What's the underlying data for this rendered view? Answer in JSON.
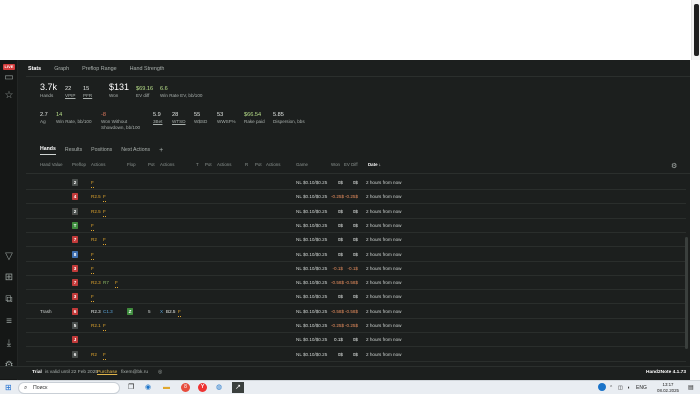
{
  "top_tabs": [
    "Stats",
    "Graph",
    "Preflop Range",
    "Hand Strength"
  ],
  "live_label": "LIVE",
  "stats": {
    "hands": {
      "value": "3.7k",
      "label": "Hands"
    },
    "vpip": {
      "value": "22",
      "label": "VPIP"
    },
    "pfr": {
      "value": "15",
      "label": "PFR"
    },
    "won": {
      "value": "$131",
      "label": "Won"
    },
    "ev_diff": {
      "value": "$69.16",
      "label": "EV diff"
    },
    "winrate_ev": {
      "value": "6.6",
      "label": "Win Rate EV, bb/100"
    },
    "ag": {
      "value": "2.7",
      "label": "Ag"
    },
    "winrate": {
      "value": "14",
      "label": "Win Rate, bb/100"
    },
    "won_without_sd": {
      "value": "-8",
      "label": "Won Without Showdown, bb/100"
    },
    "three_bet": {
      "value": "5.9",
      "label": "3Bet"
    },
    "wtsd": {
      "value": "28",
      "label": "WTSD"
    },
    "wsd": {
      "value": "55",
      "label": "W$SD"
    },
    "wwsf": {
      "value": "53",
      "label": "WWSF%"
    },
    "rake": {
      "value": "$66.54",
      "label": "Rake paid"
    },
    "dispersion": {
      "value": "5.85",
      "label": "Dispersion, bbs"
    }
  },
  "bottom_tabs": [
    "Hands",
    "Results",
    "Positions",
    "Next Actions"
  ],
  "plus_label": "+",
  "columns": {
    "hand_value": "Hand Value",
    "preflop": "Preflop",
    "actions1": "Actions",
    "flop": "Flop",
    "pot1": "Pot",
    "actions2": "Actions",
    "t": "T",
    "pot2": "Pot",
    "actions3": "Actions",
    "r": "R",
    "pot3": "Pot",
    "actions4": "Actions",
    "game": "Game",
    "won": "Won",
    "ev_diff": "EV Diff",
    "date": "Date",
    "sort_arrow": "↓"
  },
  "hands": [
    {
      "hand_value": "",
      "cards": [
        {
          "r": "8",
          "c": "black"
        },
        {
          "r": "2",
          "c": "black"
        }
      ],
      "preflop": [
        {
          "t": "F",
          "k": "f"
        }
      ],
      "flop_cards": [],
      "flop_actions": [],
      "game": "NL $0.10/$0.25",
      "won": "0$",
      "ev": "0$",
      "ev_kind": "zero",
      "date": "2 hours from now"
    },
    {
      "hand_value": "",
      "cards": [
        {
          "r": "K",
          "c": "black"
        },
        {
          "r": "4",
          "c": "red"
        }
      ],
      "preflop": [
        {
          "t": "R2.5",
          "k": "r"
        },
        {
          "t": "F",
          "k": "f"
        }
      ],
      "flop_cards": [],
      "flop_actions": [],
      "game": "NL $0.10/$0.25",
      "won": "-0.25$",
      "ev": "-0.25$",
      "ev_kind": "neg",
      "date": "2 hours from now"
    },
    {
      "hand_value": "",
      "cards": [
        {
          "r": "T",
          "c": "red"
        },
        {
          "r": "2",
          "c": "black"
        }
      ],
      "preflop": [
        {
          "t": "R2.5",
          "k": "r"
        },
        {
          "t": "F",
          "k": "f"
        }
      ],
      "flop_cards": [],
      "flop_actions": [],
      "game": "NL $0.10/$0.25",
      "won": "0$",
      "ev": "0$",
      "ev_kind": "zero",
      "date": "2 hours from now"
    },
    {
      "hand_value": "",
      "cards": [
        {
          "r": "Q",
          "c": "red"
        },
        {
          "r": "T",
          "c": "green"
        }
      ],
      "preflop": [
        {
          "t": "F",
          "k": "f"
        }
      ],
      "flop_cards": [],
      "flop_actions": [],
      "game": "NL $0.10/$0.25",
      "won": "0$",
      "ev": "0$",
      "ev_kind": "zero",
      "date": "2 hours from now"
    },
    {
      "hand_value": "",
      "cards": [
        {
          "r": "K",
          "c": "black"
        },
        {
          "r": "7",
          "c": "red"
        }
      ],
      "preflop": [
        {
          "t": "R2",
          "k": "r"
        },
        {
          "t": "F",
          "k": "f"
        }
      ],
      "flop_cards": [],
      "flop_actions": [],
      "game": "NL $0.10/$0.25",
      "won": "0$",
      "ev": "0$",
      "ev_kind": "zero",
      "date": "2 hours from now"
    },
    {
      "hand_value": "",
      "cards": [
        {
          "r": "9",
          "c": "green"
        },
        {
          "r": "8",
          "c": "blue"
        }
      ],
      "preflop": [
        {
          "t": "F",
          "k": "f"
        }
      ],
      "flop_cards": [],
      "flop_actions": [],
      "game": "NL $0.10/$0.25",
      "won": "0$",
      "ev": "0$",
      "ev_kind": "zero",
      "date": "2 hours from now"
    },
    {
      "hand_value": "",
      "cards": [
        {
          "r": "4",
          "c": "green"
        },
        {
          "r": "3",
          "c": "red"
        }
      ],
      "preflop": [
        {
          "t": "F",
          "k": "f"
        }
      ],
      "flop_cards": [],
      "flop_actions": [],
      "game": "NL $0.10/$0.25",
      "won": "-0.1$",
      "ev": "-0.1$",
      "ev_kind": "neg",
      "date": "2 hours from now"
    },
    {
      "hand_value": "",
      "cards": [
        {
          "r": "A",
          "c": "green"
        },
        {
          "r": "7",
          "c": "red"
        }
      ],
      "preflop": [
        {
          "t": "R2.3",
          "k": "r"
        },
        {
          "t": "R7",
          "k": "x"
        },
        {
          "t": "F",
          "k": "f"
        }
      ],
      "flop_cards": [],
      "flop_actions": [],
      "game": "NL $0.10/$0.25",
      "won": "-0.58$",
      "ev": "-0.58$",
      "ev_kind": "neg",
      "date": "2 hours from now"
    },
    {
      "hand_value": "",
      "cards": [
        {
          "r": "J",
          "c": "green"
        },
        {
          "r": "3",
          "c": "red"
        }
      ],
      "preflop": [
        {
          "t": "F",
          "k": "f"
        }
      ],
      "flop_cards": [],
      "flop_actions": [],
      "game": "NL $0.10/$0.25",
      "won": "0$",
      "ev": "0$",
      "ev_kind": "zero",
      "date": "2 hours from now"
    },
    {
      "hand_value": "Trash",
      "cards": [
        {
          "r": "8",
          "c": "red"
        },
        {
          "r": "6",
          "c": "red"
        }
      ],
      "preflop": [
        {
          "t": "R2.3",
          "k": "b"
        },
        {
          "t": "C1.3",
          "k": "c"
        }
      ],
      "flop_cards": [
        {
          "r": "J",
          "c": "black"
        },
        {
          "r": "9",
          "c": "red"
        },
        {
          "r": "Z",
          "c": "green"
        }
      ],
      "flop_pot": "5",
      "flop_actions": [
        {
          "t": "X",
          "k": "c"
        },
        {
          "t": "B2.5",
          "k": "b"
        },
        {
          "t": "F",
          "k": "f"
        }
      ],
      "game": "NL $0.10/$0.25",
      "won": "-0.58$",
      "ev": "-0.58$",
      "ev_kind": "neg",
      "date": "2 hours from now"
    },
    {
      "hand_value": "",
      "cards": [
        {
          "r": "K",
          "c": "blue"
        },
        {
          "r": "5",
          "c": "black"
        }
      ],
      "preflop": [
        {
          "t": "R2.1",
          "k": "r"
        },
        {
          "t": "F",
          "k": "f"
        }
      ],
      "flop_cards": [],
      "flop_actions": [],
      "game": "NL $0.10/$0.25",
      "won": "-0.25$",
      "ev": "-0.25$",
      "ev_kind": "neg",
      "date": "2 hours from now"
    },
    {
      "hand_value": "",
      "cards": [
        {
          "r": "K",
          "c": "black"
        },
        {
          "r": "J",
          "c": "red"
        }
      ],
      "preflop": [],
      "flop_cards": [],
      "flop_actions": [],
      "game": "NL $0.10/$0.25",
      "won": "0.1$",
      "ev": "0$",
      "ev_kind": "pos",
      "date": "2 hours from now"
    },
    {
      "hand_value": "",
      "cards": [
        {
          "r": "K",
          "c": "black"
        },
        {
          "r": "6",
          "c": "black"
        }
      ],
      "preflop": [
        {
          "t": "R2",
          "k": "r"
        },
        {
          "t": "F",
          "k": "f"
        }
      ],
      "flop_cards": [],
      "flop_actions": [],
      "game": "NL $0.10/$0.25",
      "won": "0$",
      "ev": "0$",
      "ev_kind": "zero",
      "date": "2 hours from now"
    }
  ],
  "status": {
    "trial": "Trial",
    "valid": "is valid until 22 Feb 2025",
    "purchase": "Purchase",
    "email": "fixem@bk.ru",
    "app_version": "Hand2Note 4.1.73"
  },
  "taskbar": {
    "search_placeholder": "Поиск",
    "lang": "ENG",
    "time": "13:17",
    "date": "08.02.2025",
    "yandex_glyph": "Y",
    "badge_count": "8"
  }
}
